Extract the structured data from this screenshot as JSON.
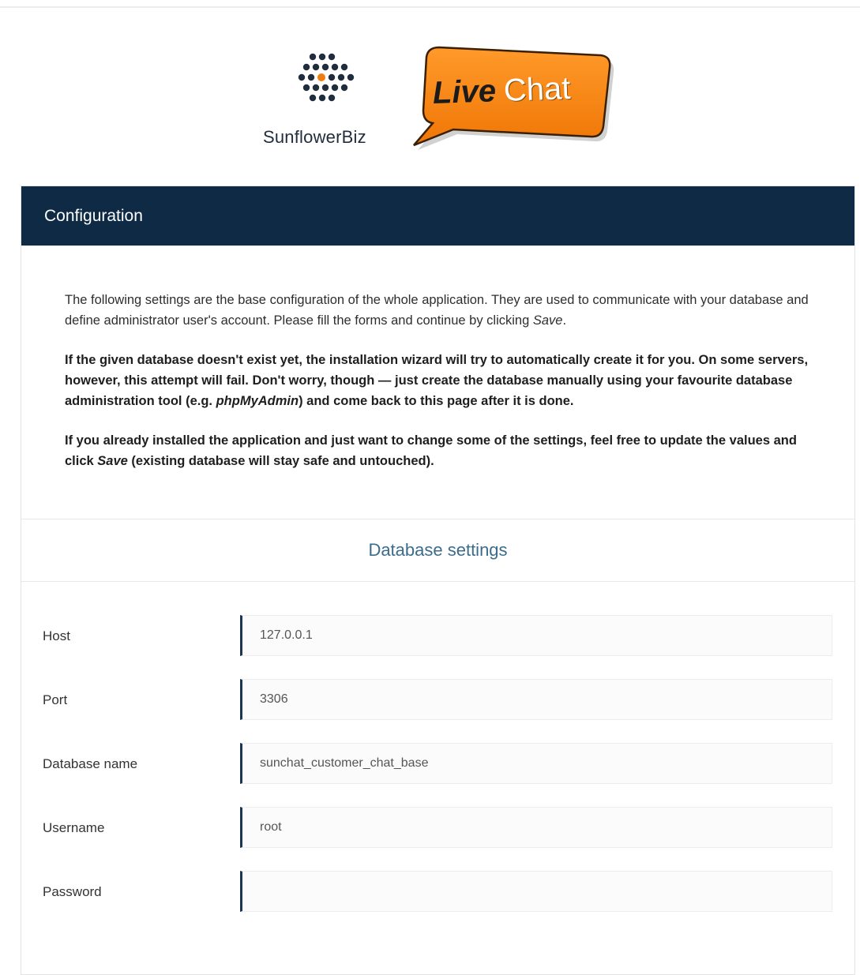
{
  "logo": {
    "brand_name": "SunflowerBiz",
    "badge_live": "Live",
    "badge_chat": "Chat",
    "accent_color": "#f07d10",
    "dot_color": "#1f2d3d"
  },
  "panel": {
    "title": "Configuration",
    "header_color": "#0e2a45",
    "intro": {
      "p1_pre": "The following settings are the base configuration of the whole application. They are used to communicate with your database and define administrator user's account. Please fill the forms and continue by clicking ",
      "p1_em": "Save",
      "p1_post": ".",
      "p2_pre": "If the given database doesn't exist yet, the installation wizard will try to automatically create it for you. On some servers, however, this attempt will fail. Don't worry, though — just create the database manually using your favourite database administration tool (e.g. ",
      "p2_em": "phpMyAdmin",
      "p2_post": ") and come back to this page after it is done.",
      "p3_pre": "If you already installed the application and just want to change some of the settings, feel free to update the values and click ",
      "p3_em": "Save",
      "p3_post": " (existing database will stay safe and untouched)."
    },
    "section_title": "Database settings",
    "fields": {
      "host": {
        "label": "Host",
        "value": "127.0.0.1"
      },
      "port": {
        "label": "Port",
        "value": "3306"
      },
      "dbname": {
        "label": "Database name",
        "value": "sunchat_customer_chat_base"
      },
      "username": {
        "label": "Username",
        "value": "root"
      },
      "password": {
        "label": "Password",
        "value": ""
      }
    }
  }
}
